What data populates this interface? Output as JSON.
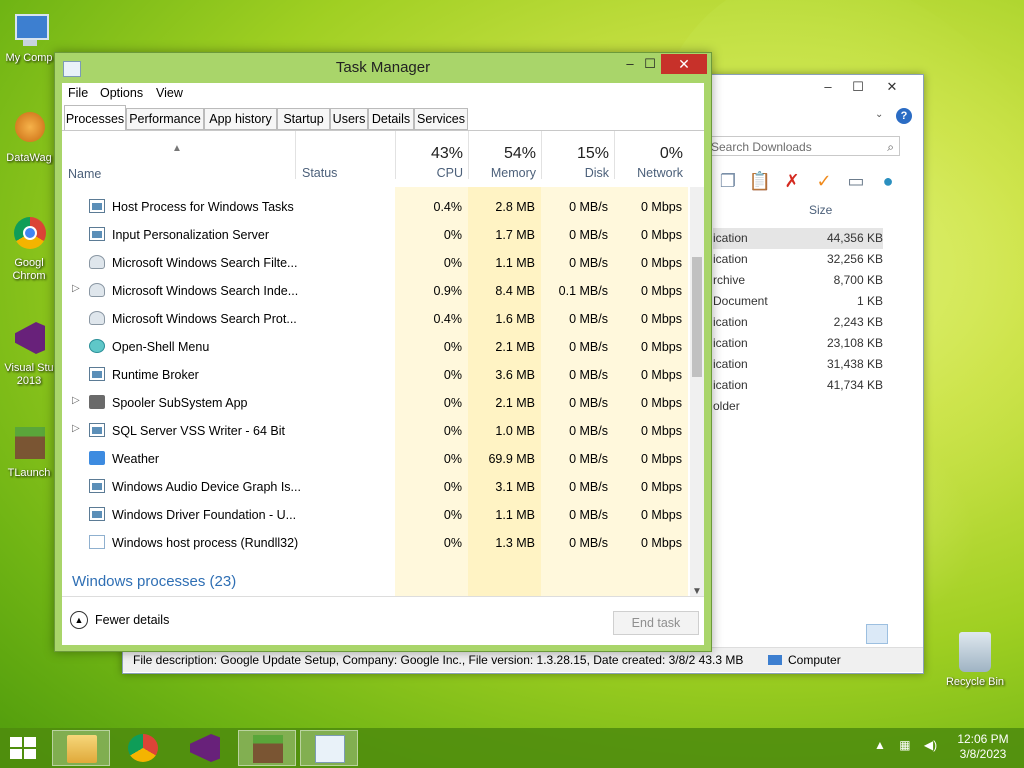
{
  "desktop": {
    "icons": [
      {
        "label": "My Comp"
      },
      {
        "label": "DataWag"
      },
      {
        "label": "Googl Chrom"
      },
      {
        "label": "Visual Stu 2013"
      },
      {
        "label": "TLaunch"
      }
    ],
    "recycle_bin": "Recycle Bin"
  },
  "explorer": {
    "search_placeholder": "Search Downloads",
    "size_header": "Size",
    "type_header": "e",
    "rows": [
      {
        "type": "ication",
        "size": "44,356 KB"
      },
      {
        "type": "ication",
        "size": "32,256 KB"
      },
      {
        "type": "rchive",
        "size": "8,700 KB"
      },
      {
        "type": "Document",
        "size": "1 KB"
      },
      {
        "type": "ication",
        "size": "2,243 KB"
      },
      {
        "type": "ication",
        "size": "23,108 KB"
      },
      {
        "type": "ication",
        "size": "31,438 KB"
      },
      {
        "type": "ication",
        "size": "41,734 KB"
      },
      {
        "type": "older",
        "size": ""
      }
    ],
    "status_desc": "File description: Google Update Setup, Company: Google Inc., File version: 1.3.28.15, Date created: 3/8/2 43.3 MB",
    "status_location": "Computer"
  },
  "taskmanager": {
    "title": "Task Manager",
    "menu": [
      "File",
      "Options",
      "View"
    ],
    "tabs": [
      "Processes",
      "Performance",
      "App history",
      "Startup",
      "Users",
      "Details",
      "Services"
    ],
    "columns": {
      "name": "Name",
      "status": "Status",
      "cpu": {
        "pct": "43%",
        "label": "CPU"
      },
      "memory": {
        "pct": "54%",
        "label": "Memory"
      },
      "disk": {
        "pct": "15%",
        "label": "Disk"
      },
      "network": {
        "pct": "0%",
        "label": "Network"
      }
    },
    "processes": [
      {
        "name": "Host Process for Windows Tasks",
        "cpu": "0.4%",
        "mem": "2.8 MB",
        "disk": "0 MB/s",
        "net": "0 Mbps",
        "expand": false,
        "icon": "window"
      },
      {
        "name": "Input Personalization Server",
        "cpu": "0%",
        "mem": "1.7 MB",
        "disk": "0 MB/s",
        "net": "0 Mbps",
        "expand": false,
        "icon": "window"
      },
      {
        "name": "Microsoft Windows Search Filte...",
        "cpu": "0%",
        "mem": "1.1 MB",
        "disk": "0 MB/s",
        "net": "0 Mbps",
        "expand": false,
        "icon": "user"
      },
      {
        "name": "Microsoft Windows Search Inde...",
        "cpu": "0.9%",
        "mem": "8.4 MB",
        "disk": "0.1 MB/s",
        "net": "0 Mbps",
        "expand": true,
        "icon": "user"
      },
      {
        "name": "Microsoft Windows Search Prot...",
        "cpu": "0.4%",
        "mem": "1.6 MB",
        "disk": "0 MB/s",
        "net": "0 Mbps",
        "expand": false,
        "icon": "user"
      },
      {
        "name": "Open-Shell Menu",
        "cpu": "0%",
        "mem": "2.1 MB",
        "disk": "0 MB/s",
        "net": "0 Mbps",
        "expand": false,
        "icon": "shell"
      },
      {
        "name": "Runtime Broker",
        "cpu": "0%",
        "mem": "3.6 MB",
        "disk": "0 MB/s",
        "net": "0 Mbps",
        "expand": false,
        "icon": "window"
      },
      {
        "name": "Spooler SubSystem App",
        "cpu": "0%",
        "mem": "2.1 MB",
        "disk": "0 MB/s",
        "net": "0 Mbps",
        "expand": true,
        "icon": "printer"
      },
      {
        "name": "SQL Server VSS Writer - 64 Bit",
        "cpu": "0%",
        "mem": "1.0 MB",
        "disk": "0 MB/s",
        "net": "0 Mbps",
        "expand": true,
        "icon": "window"
      },
      {
        "name": "Weather",
        "cpu": "0%",
        "mem": "69.9 MB",
        "disk": "0 MB/s",
        "net": "0 Mbps",
        "expand": false,
        "icon": "weather"
      },
      {
        "name": "Windows Audio Device Graph Is...",
        "cpu": "0%",
        "mem": "3.1 MB",
        "disk": "0 MB/s",
        "net": "0 Mbps",
        "expand": false,
        "icon": "window"
      },
      {
        "name": "Windows Driver Foundation - U...",
        "cpu": "0%",
        "mem": "1.1 MB",
        "disk": "0 MB/s",
        "net": "0 Mbps",
        "expand": false,
        "icon": "window"
      },
      {
        "name": "Windows host process (Rundll32)",
        "cpu": "0%",
        "mem": "1.3 MB",
        "disk": "0 MB/s",
        "net": "0 Mbps",
        "expand": false,
        "icon": "doc"
      }
    ],
    "group_label": "Windows processes (23)",
    "fewer_details": "Fewer details",
    "end_task": "End task"
  },
  "taskbar": {
    "time": "12:06 PM",
    "date": "3/8/2023"
  }
}
